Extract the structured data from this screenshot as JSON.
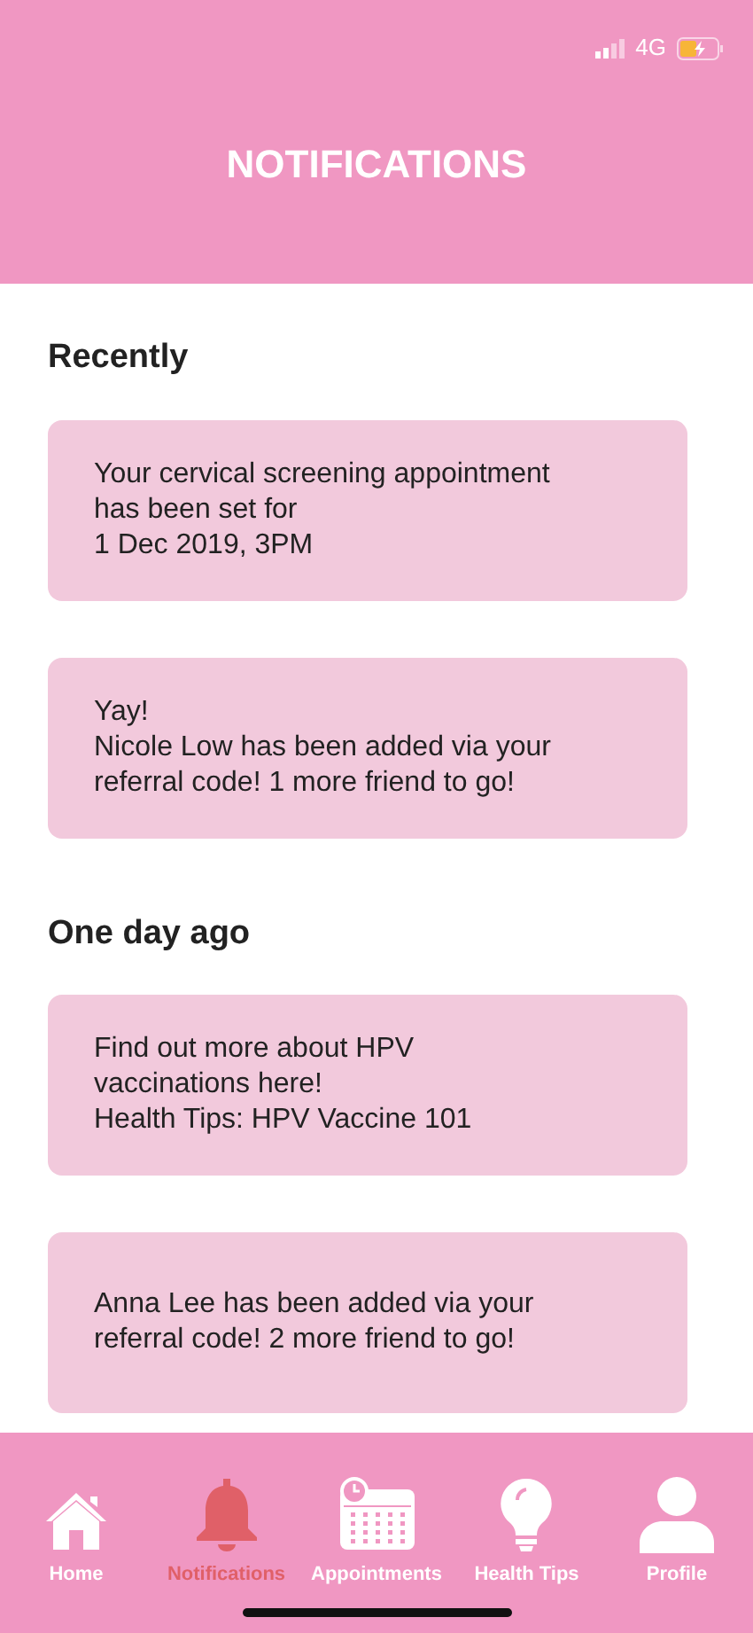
{
  "status_bar": {
    "network": "4G"
  },
  "header": {
    "title": "NOTIFICATIONS"
  },
  "sections": [
    {
      "heading": "Recently",
      "notifications": [
        {
          "lines": [
            "Your cervical screening appointment",
            "has been set for",
            "1 Dec 2019, 3PM"
          ]
        },
        {
          "lines": [
            "Yay!",
            "Nicole Low has been added via your",
            "referral code! 1 more friend to go!"
          ]
        }
      ]
    },
    {
      "heading": "One day ago",
      "notifications": [
        {
          "lines": [
            "Find out more about HPV",
            "vaccinations here!",
            "Health Tips: HPV Vaccine 101"
          ]
        },
        {
          "lines": [
            "Anna Lee has been added via your",
            "referral code! 2 more friend to go!"
          ]
        }
      ]
    }
  ],
  "nav": [
    {
      "kind": "home",
      "label": "Home",
      "selected": false
    },
    {
      "kind": "bell",
      "label": "Notifications",
      "selected": true
    },
    {
      "kind": "calendar",
      "label": "Appointments",
      "selected": false
    },
    {
      "kind": "bulb",
      "label": "Health Tips",
      "selected": false
    },
    {
      "kind": "person",
      "label": "Profile",
      "selected": false
    }
  ]
}
